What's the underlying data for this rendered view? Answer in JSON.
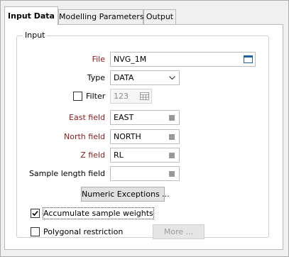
{
  "tabs": [
    {
      "label": "Input Data"
    },
    {
      "label": "Modelling Parameters"
    },
    {
      "label": "Output"
    }
  ],
  "group": {
    "title": "Input"
  },
  "file": {
    "label": "File",
    "value": "NVG_1M"
  },
  "type": {
    "label": "Type",
    "value": "DATA"
  },
  "filter": {
    "label": "Filter",
    "checked": false,
    "value": "123"
  },
  "east_field": {
    "label": "East field",
    "value": "EAST"
  },
  "north_field": {
    "label": "North field",
    "value": "NORTH"
  },
  "z_field": {
    "label": "Z field",
    "value": "RL"
  },
  "sample_length": {
    "label": "Sample length field",
    "value": ""
  },
  "numeric_exceptions": {
    "label": "Numeric Exceptions ..."
  },
  "accumulate": {
    "label": "Accumulate sample weights",
    "checked": true
  },
  "polygonal": {
    "label": "Polygonal restriction",
    "checked": false
  },
  "more": {
    "label": "More ..."
  },
  "colors": {
    "required_label": "#8c1a1a",
    "accent": "#1f5fa8"
  }
}
